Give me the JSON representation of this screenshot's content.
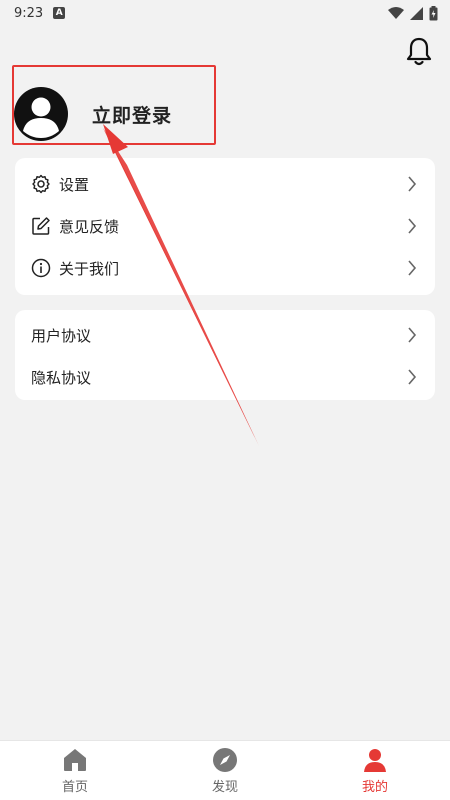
{
  "status_bar": {
    "time": "9:23",
    "notice_glyph": "A"
  },
  "header": {
    "bell_icon": "bell-icon"
  },
  "profile": {
    "login_label": "立即登录"
  },
  "menu_group_1": [
    {
      "label": "设置",
      "icon": "gear-icon"
    },
    {
      "label": "意见反馈",
      "icon": "edit-icon"
    },
    {
      "label": "关于我们",
      "icon": "info-icon"
    }
  ],
  "menu_group_2": [
    {
      "label": "用户协议"
    },
    {
      "label": "隐私协议"
    }
  ],
  "tabbar": {
    "tabs": [
      {
        "label": "首页",
        "icon": "home-icon",
        "active": false
      },
      {
        "label": "发现",
        "icon": "compass-icon",
        "active": false
      },
      {
        "label": "我的",
        "icon": "user-icon",
        "active": true
      }
    ]
  },
  "colors": {
    "accent": "#e53935",
    "background": "#f2f2f2",
    "card": "#ffffff"
  }
}
